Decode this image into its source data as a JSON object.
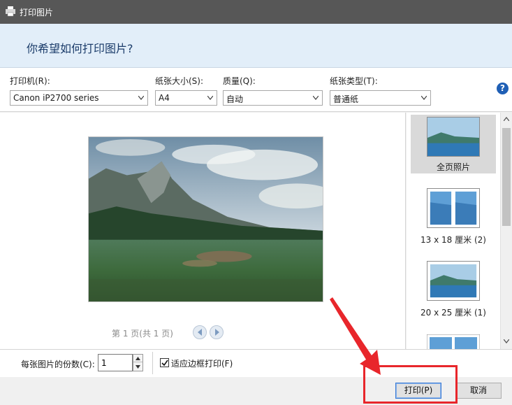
{
  "window": {
    "title": "打印图片"
  },
  "header": {
    "heading": "你希望如何打印图片?"
  },
  "options": {
    "printer": {
      "label": "打印机(R):",
      "value": "Canon iP2700 series"
    },
    "paper_size": {
      "label": "纸张大小(S):",
      "value": "A4"
    },
    "quality": {
      "label": "质量(Q):",
      "value": "自动"
    },
    "paper_type": {
      "label": "纸张类型(T):",
      "value": "普通纸"
    },
    "help_glyph": "?"
  },
  "preview": {
    "page_indicator": "第 1 页(共 1 页)"
  },
  "layouts": [
    {
      "label": "全页照片",
      "selected": true
    },
    {
      "label": "13 x 18 厘米 (2)",
      "selected": false
    },
    {
      "label": "20 x 25 厘米 (1)",
      "selected": false
    }
  ],
  "bottom": {
    "copies_label": "每张图片的份数(C):",
    "copies_value": "1",
    "fit_label": "适应边框打印(F)",
    "fit_checked": true
  },
  "footer": {
    "print_label": "打印(P)",
    "cancel_label": "取消"
  },
  "colors": {
    "annotation": "#e8262b",
    "header_bg": "#e2eef9",
    "titlebar_bg": "#575757"
  }
}
